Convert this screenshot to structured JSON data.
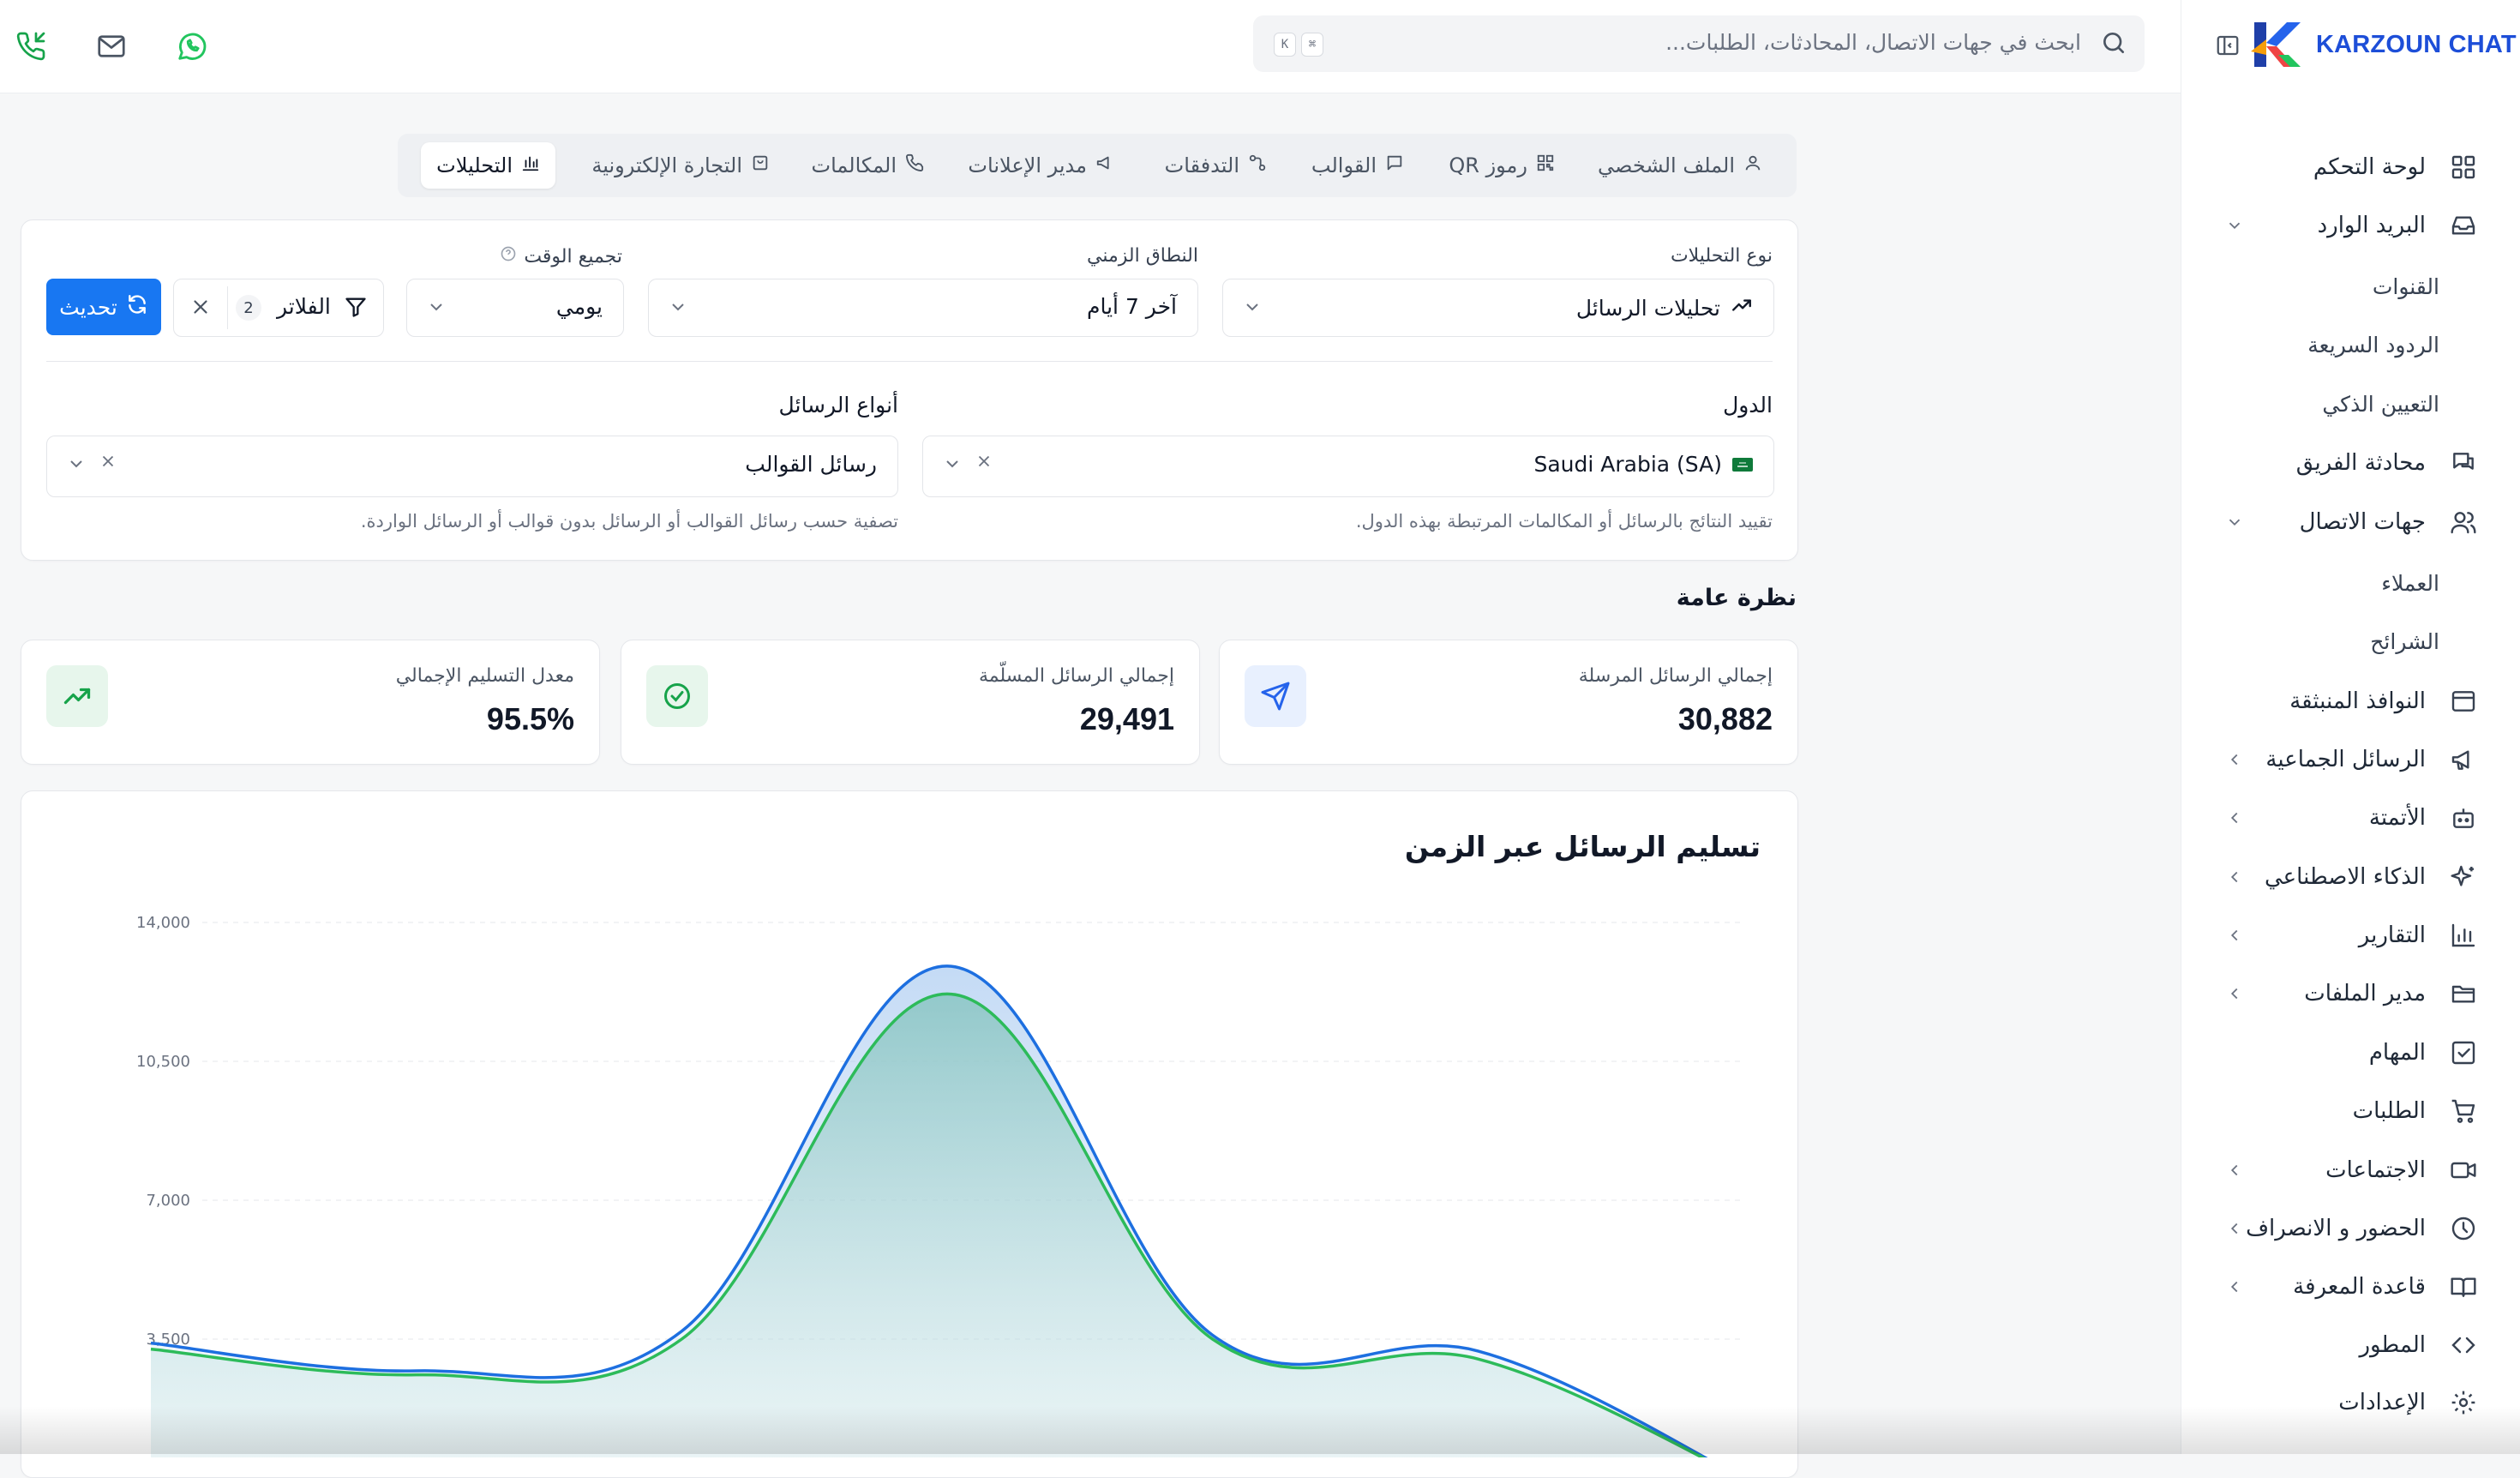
{
  "brand": {
    "name": "KARZOUN CHAT"
  },
  "search": {
    "placeholder": "ابحث في جهات الاتصال، المحادثات، الطلبات...",
    "kbd1": "K",
    "kbd2": "⌘"
  },
  "sidebar": {
    "items": [
      {
        "label": "لوحة التحكم",
        "icon": "dashboard-icon"
      },
      {
        "label": "البريد الوارد",
        "icon": "inbox-icon",
        "chevron": "down"
      },
      {
        "label": "محادثة الفريق",
        "icon": "team-chat-icon"
      },
      {
        "label": "جهات الاتصال",
        "icon": "contacts-icon",
        "chevron": "down"
      },
      {
        "label": "النوافذ المنبثقة",
        "icon": "popup-window-icon"
      },
      {
        "label": "الرسائل الجماعية",
        "icon": "megaphone-icon",
        "chevron": "left"
      },
      {
        "label": "الأتمتة",
        "icon": "bot-icon",
        "chevron": "left"
      },
      {
        "label": "الذكاء الاصطناعي",
        "icon": "sparkles-icon",
        "chevron": "left"
      },
      {
        "label": "التقارير",
        "icon": "bar-chart-icon",
        "chevron": "left"
      },
      {
        "label": "مدير الملفات",
        "icon": "folder-icon",
        "chevron": "left"
      },
      {
        "label": "المهام",
        "icon": "checkbox-icon"
      },
      {
        "label": "الطلبات",
        "icon": "cart-icon"
      },
      {
        "label": "الاجتماعات",
        "icon": "video-icon",
        "chevron": "left"
      },
      {
        "label": "الحضور و الانصراف",
        "icon": "clock-icon",
        "chevron": "left"
      },
      {
        "label": "قاعدة المعرفة",
        "icon": "book-icon",
        "chevron": "left"
      },
      {
        "label": "المطور",
        "icon": "code-icon"
      },
      {
        "label": "الإعدادات",
        "icon": "gear-icon"
      }
    ],
    "inbox_sub": [
      "القنوات",
      "الردود السريعة",
      "التعيين الذكي"
    ],
    "contacts_sub": [
      "العملاء",
      "الشرائح"
    ]
  },
  "tabs": [
    {
      "label": "الملف الشخصي",
      "icon": "user-icon"
    },
    {
      "label": "رموز QR",
      "icon": "qr-icon"
    },
    {
      "label": "القوالب",
      "icon": "message-square-icon"
    },
    {
      "label": "التدفقات",
      "icon": "flow-icon"
    },
    {
      "label": "مدير الإعلانات",
      "icon": "megaphone-icon"
    },
    {
      "label": "المكالمات",
      "icon": "phone-icon"
    },
    {
      "label": "التجارة الإلكترونية",
      "icon": "shopping-bag-icon"
    },
    {
      "label": "التحليلات",
      "icon": "analytics-icon",
      "active": true
    }
  ],
  "filters": {
    "analytics_type_label": "نوع التحليلات",
    "analytics_type_value": "تحليلات الرسائل",
    "range_label": "النطاق الزمني",
    "range_value": "آخر 7 أيام",
    "grouping_label": "تجميع الوقت",
    "grouping_value": "يومي",
    "filters_button": "الفلاتر",
    "filters_count": "2",
    "refresh_button": "تحديث",
    "countries_label": "الدول",
    "countries_value": "Saudi Arabia (SA)",
    "countries_hint": "تقييد النتائج بالرسائل أو المكالمات المرتبطة بهذه الدول.",
    "message_types_label": "أنواع الرسائل",
    "message_types_value": "رسائل القوالب",
    "message_types_hint": "تصفية حسب رسائل القوالب أو الرسائل بدون قوالب أو الرسائل الواردة."
  },
  "overview": {
    "title": "نظرة عامة",
    "stats": [
      {
        "title": "إجمالي الرسائل المرسلة",
        "value": "30,882",
        "icon": "send-icon",
        "color": "#2563eb"
      },
      {
        "title": "إجمالي الرسائل المسلّمة",
        "value": "29,491",
        "icon": "check-circle-icon",
        "color": "#16a34a"
      },
      {
        "title": "معدل التسليم الإجمالي",
        "value": "95.5%",
        "icon": "trending-up-icon",
        "color": "#16a34a"
      }
    ]
  },
  "chart_data": {
    "type": "area",
    "title": "تسليم الرسائل عبر الزمن",
    "x": [
      1,
      2,
      3,
      4,
      5,
      6,
      7
    ],
    "ylim": [
      0,
      14000
    ],
    "yticks": [
      "14,000",
      "10,500",
      "7,000",
      "3,500"
    ],
    "grid": true,
    "series": [
      {
        "values": [
          3400,
          2700,
          3700,
          12900,
          3600,
          3200,
          0
        ],
        "color": "#1d6fe0"
      },
      {
        "values": [
          3250,
          2600,
          3500,
          12200,
          3500,
          3000,
          0
        ],
        "color": "#2dbb5a"
      }
    ]
  },
  "colors": {
    "accent": "#1877f2",
    "sidebar_bg": "#ffffff",
    "page_bg": "#f6f7f8"
  }
}
